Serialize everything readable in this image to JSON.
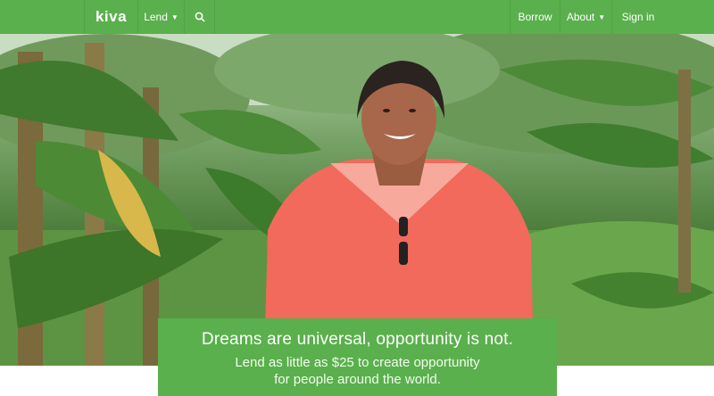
{
  "nav": {
    "logo": "kiva",
    "lend_label": "Lend",
    "borrow_label": "Borrow",
    "about_label": "About",
    "signin_label": "Sign in",
    "search_icon": "search-icon",
    "dropdown_icon": "chevron-down-icon"
  },
  "hero": {
    "headline": "Dreams are universal, opportunity is not.",
    "sub_line1": "Lend as little as $25 to create opportunity",
    "sub_line2": "for people around the world."
  },
  "colors": {
    "brand_green": "#5ab04c",
    "shirt": "#f26a5c"
  }
}
